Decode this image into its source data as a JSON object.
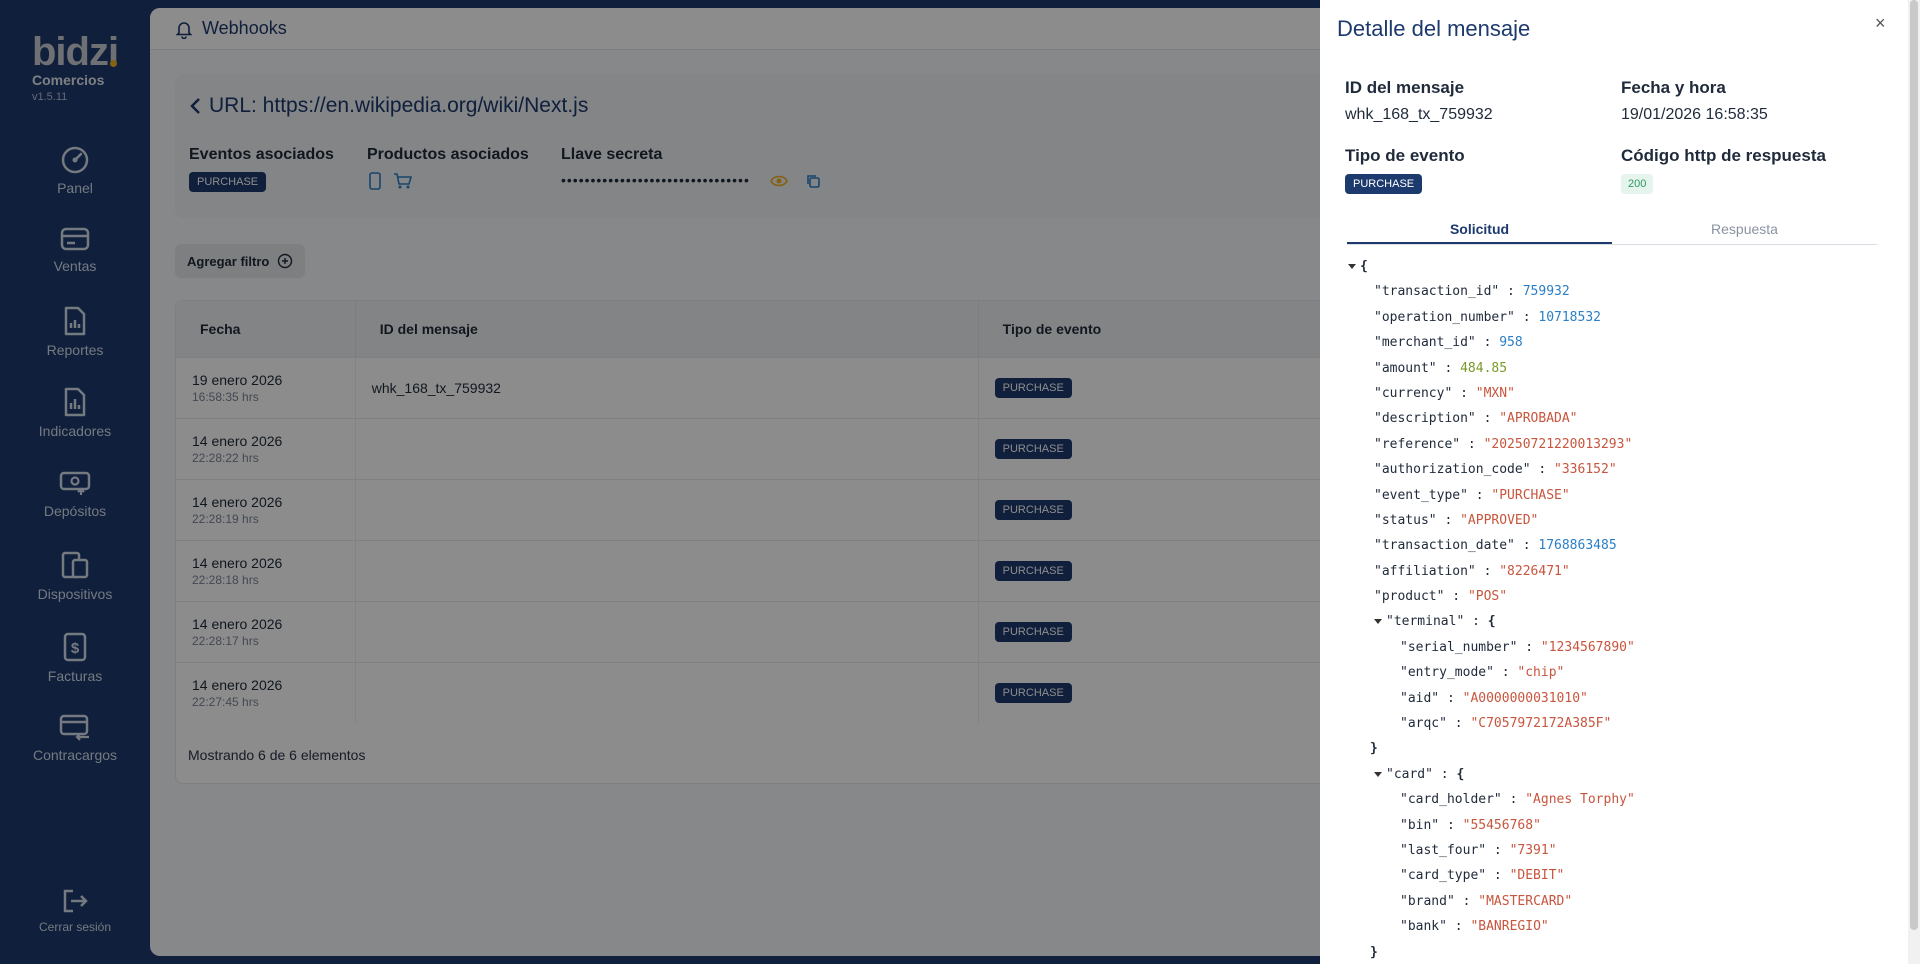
{
  "sidebar": {
    "logo": "bidzi",
    "brand": "Comercios",
    "version": "v1.5.11",
    "items": [
      {
        "label": "Panel",
        "icon": "gauge-icon"
      },
      {
        "label": "Ventas",
        "icon": "card-icon"
      },
      {
        "label": "Reportes",
        "icon": "report-icon"
      },
      {
        "label": "Indicadores",
        "icon": "chart-doc-icon"
      },
      {
        "label": "Depósitos",
        "icon": "deposit-icon"
      },
      {
        "label": "Dispositivos",
        "icon": "devices-icon"
      },
      {
        "label": "Facturas",
        "icon": "invoice-icon"
      },
      {
        "label": "Contracargos",
        "icon": "chargeback-icon"
      }
    ],
    "logout": "Cerrar sesión"
  },
  "main": {
    "title": "Webhooks",
    "url": "URL: https://en.wikipedia.org/wiki/Next.js",
    "events_title": "Eventos asociados",
    "event_badge": "PURCHASE",
    "products_title": "Productos asociados",
    "secret_title": "Llave secreta",
    "secret_value": "••••••••••••••••••••••••••••••••",
    "filter_label": "Agregar filtro",
    "table": {
      "headers": [
        "Fecha",
        "ID del mensaje",
        "Tipo de evento"
      ],
      "rows": [
        {
          "date": "19 enero 2026",
          "time": "16:58:35 hrs",
          "id": "whk_168_tx_759932",
          "type": "PURCHASE"
        },
        {
          "date": "14 enero 2026",
          "time": "22:28:22 hrs",
          "id": "",
          "type": "PURCHASE"
        },
        {
          "date": "14 enero 2026",
          "time": "22:28:19 hrs",
          "id": "",
          "type": "PURCHASE"
        },
        {
          "date": "14 enero 2026",
          "time": "22:28:18 hrs",
          "id": "",
          "type": "PURCHASE"
        },
        {
          "date": "14 enero 2026",
          "time": "22:28:17 hrs",
          "id": "",
          "type": "PURCHASE"
        },
        {
          "date": "14 enero 2026",
          "time": "22:27:45 hrs",
          "id": "",
          "type": "PURCHASE"
        }
      ],
      "footer": "Mostrando 6 de 6 elementos"
    }
  },
  "drawer": {
    "title": "Detalle del mensaje",
    "close": "×",
    "message_id_label": "ID del mensaje",
    "message_id": "whk_168_tx_759932",
    "datetime_label": "Fecha y hora",
    "datetime": "19/01/2026 16:58:35",
    "event_type_label": "Tipo de evento",
    "event_type": "PURCHASE",
    "http_code_label": "Código http de respuesta",
    "http_code": "200",
    "tabs": [
      "Solicitud",
      "Respuesta"
    ],
    "json_lines": [
      {
        "indent": 0,
        "kind": "open",
        "caret": true,
        "text": "{"
      },
      {
        "indent": 1,
        "key": "\"transaction_id\"",
        "value": "759932",
        "vtype": "num"
      },
      {
        "indent": 1,
        "key": "\"operation_number\"",
        "value": "10718532",
        "vtype": "num"
      },
      {
        "indent": 1,
        "key": "\"merchant_id\"",
        "value": "958",
        "vtype": "num"
      },
      {
        "indent": 1,
        "key": "\"amount\"",
        "value": "484.85",
        "vtype": "dec"
      },
      {
        "indent": 1,
        "key": "\"currency\"",
        "value": "\"MXN\"",
        "vtype": "str"
      },
      {
        "indent": 1,
        "key": "\"description\"",
        "value": "\"APROBADA\"",
        "vtype": "str"
      },
      {
        "indent": 1,
        "key": "\"reference\"",
        "value": "\"20250721220013293\"",
        "vtype": "str"
      },
      {
        "indent": 1,
        "key": "\"authorization_code\"",
        "value": "\"336152\"",
        "vtype": "str"
      },
      {
        "indent": 1,
        "key": "\"event_type\"",
        "value": "\"PURCHASE\"",
        "vtype": "str"
      },
      {
        "indent": 1,
        "key": "\"status\"",
        "value": "\"APPROVED\"",
        "vtype": "str"
      },
      {
        "indent": 1,
        "key": "\"transaction_date\"",
        "value": "1768863485",
        "vtype": "num"
      },
      {
        "indent": 1,
        "key": "\"affiliation\"",
        "value": "\"8226471\"",
        "vtype": "str"
      },
      {
        "indent": 1,
        "key": "\"product\"",
        "value": "\"POS\"",
        "vtype": "str"
      },
      {
        "indent": 1,
        "key": "\"terminal\"",
        "value": "{",
        "vtype": "obj",
        "caret": true
      },
      {
        "indent": 2,
        "key": "\"serial_number\"",
        "value": "\"1234567890\"",
        "vtype": "str"
      },
      {
        "indent": 2,
        "key": "\"entry_mode\"",
        "value": "\"chip\"",
        "vtype": "str"
      },
      {
        "indent": 2,
        "key": "\"aid\"",
        "value": "\"A0000000031010\"",
        "vtype": "str"
      },
      {
        "indent": 2,
        "key": "\"arqc\"",
        "value": "\"C7057972172A385F\"",
        "vtype": "str"
      },
      {
        "indent": 1,
        "kind": "close",
        "text": "}"
      },
      {
        "indent": 1,
        "key": "\"card\"",
        "value": "{",
        "vtype": "obj",
        "caret": true
      },
      {
        "indent": 2,
        "key": "\"card_holder\"",
        "value": "\"Agnes Torphy\"",
        "vtype": "str"
      },
      {
        "indent": 2,
        "key": "\"bin\"",
        "value": "\"55456768\"",
        "vtype": "str"
      },
      {
        "indent": 2,
        "key": "\"last_four\"",
        "value": "\"7391\"",
        "vtype": "str"
      },
      {
        "indent": 2,
        "key": "\"card_type\"",
        "value": "\"DEBIT\"",
        "vtype": "str"
      },
      {
        "indent": 2,
        "key": "\"brand\"",
        "value": "\"MASTERCARD\"",
        "vtype": "str"
      },
      {
        "indent": 2,
        "key": "\"bank\"",
        "value": "\"BANREGIO\"",
        "vtype": "str"
      },
      {
        "indent": 1,
        "kind": "close",
        "text": "}"
      },
      {
        "indent": 0,
        "kind": "close",
        "text": "}"
      }
    ]
  },
  "colors": {
    "sidebar": "#1c3a6e",
    "accent": "#1c3a6e",
    "json_number": "#2a7fc8",
    "json_string": "#c8553d",
    "json_decimal": "#7a9a2a",
    "status_ok": "#2f9a5f",
    "eye_icon": "#f2b01e"
  }
}
